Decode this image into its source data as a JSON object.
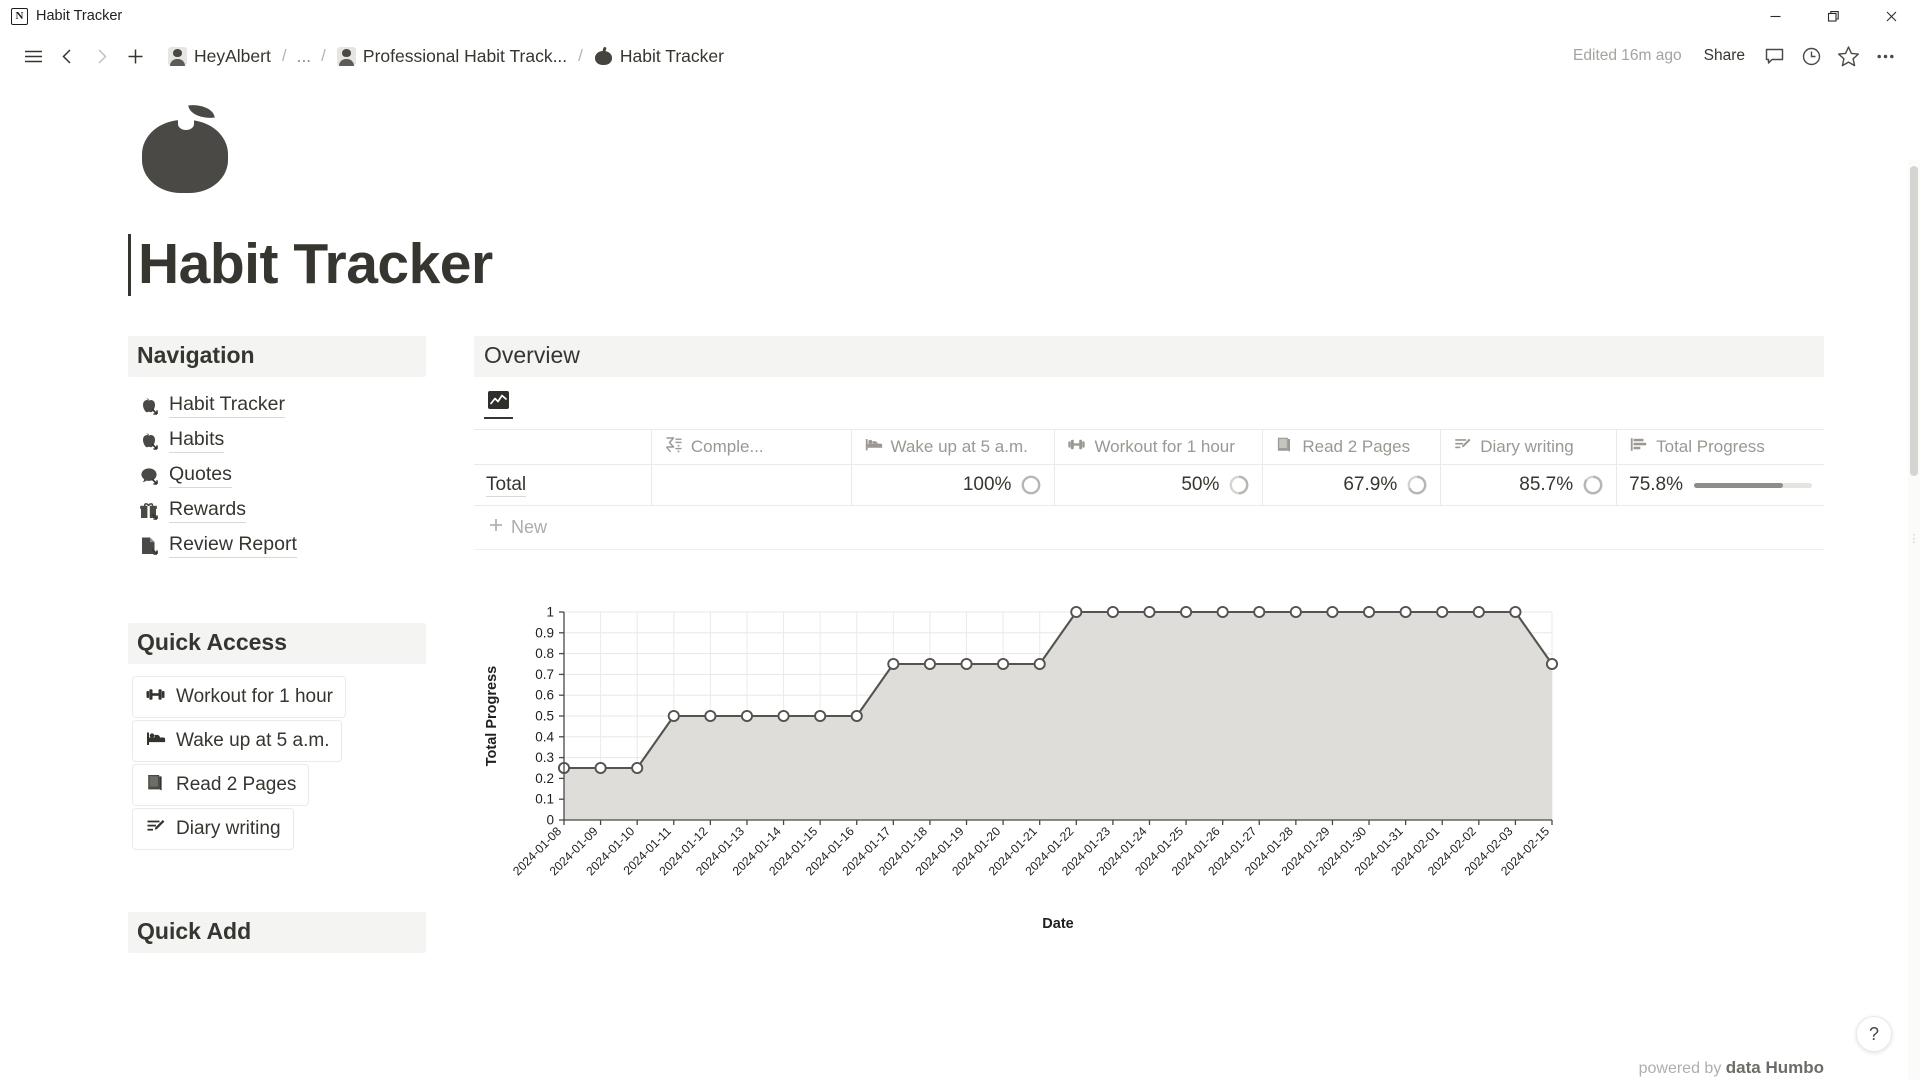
{
  "window": {
    "app_icon": "notion-icon",
    "title": "Habit Tracker",
    "minimize_label": "Minimize",
    "restore_label": "Restore",
    "close_label": "Close"
  },
  "appbar": {
    "menu_label": "Menu",
    "back_label": "Back",
    "forward_label": "Forward",
    "new_label": "New",
    "breadcrumbs": [
      {
        "icon": "avatar-icon",
        "label": "HeyAlbert"
      },
      {
        "icon": "none",
        "label": "..."
      },
      {
        "icon": "avatar-icon",
        "label": "Professional Habit Track..."
      },
      {
        "icon": "apple-icon",
        "label": "Habit Tracker"
      }
    ],
    "separator": "/",
    "edited": "Edited 16m ago",
    "share_label": "Share",
    "comment_label": "Comments",
    "history_label": "Updates",
    "favorite_label": "Favorite",
    "more_label": "More"
  },
  "page": {
    "emoji": "apple-icon",
    "title": "Habit Tracker"
  },
  "navigation": {
    "heading": "Navigation",
    "items": [
      {
        "icon": "apple-icon",
        "label": "Habit Tracker"
      },
      {
        "icon": "apple-icon",
        "label": "Habits"
      },
      {
        "icon": "speech-bubble-icon",
        "label": "Quotes"
      },
      {
        "icon": "gift-icon",
        "label": "Rewards"
      },
      {
        "icon": "document-icon",
        "label": "Review Report"
      }
    ]
  },
  "quick_access": {
    "heading": "Quick Access",
    "items": [
      {
        "icon": "dumbbell-icon",
        "label": "Workout for 1 hour"
      },
      {
        "icon": "bed-icon",
        "label": "Wake up at 5 a.m."
      },
      {
        "icon": "book-icon",
        "label": "Read 2 Pages"
      },
      {
        "icon": "pencil-lines-icon",
        "label": "Diary writing"
      }
    ]
  },
  "quick_add": {
    "heading": "Quick Add"
  },
  "overview": {
    "heading": "Overview",
    "tab_icon": "line-chart-icon",
    "columns": [
      {
        "icon": "sigma-icon",
        "label": "Comple..."
      },
      {
        "icon": "bed-icon",
        "label": "Wake up at 5 a.m."
      },
      {
        "icon": "dumbbell-icon",
        "label": "Workout for 1 hour"
      },
      {
        "icon": "book-icon",
        "label": "Read 2 Pages"
      },
      {
        "icon": "pencil-lines-icon",
        "label": "Diary writing"
      },
      {
        "icon": "bar-chart-icon",
        "label": "Total Progress"
      }
    ],
    "rows": [
      {
        "name": "Total",
        "wake_up": "100%",
        "wake_up_pct": 100,
        "workout": "50%",
        "workout_pct": 50,
        "read": "67.9%",
        "read_pct": 67.9,
        "diary": "85.7%",
        "diary_pct": 85.7,
        "total_progress": "75.8%",
        "total_progress_pct": 75.8
      }
    ],
    "new_row_label": "New",
    "new_row_icon": "plus-icon"
  },
  "chart_data": {
    "type": "area",
    "title": "",
    "xlabel": "Date",
    "ylabel": "Total Progress",
    "ylim": [
      0,
      1
    ],
    "yticks": [
      0,
      0.1,
      0.2,
      0.3,
      0.4,
      0.5,
      0.6,
      0.7,
      0.8,
      0.9,
      1
    ],
    "ytick_labels": [
      "0",
      "0.1",
      "0.2",
      "0.3",
      "0.4",
      "0.5",
      "0.6",
      "0.7",
      "0.8",
      "0.9",
      "1"
    ],
    "grid": true,
    "legend": "none",
    "line_color": "#555350",
    "fill_color": "#dddbd8",
    "marker": "circle-open",
    "categories": [
      "2024-01-08",
      "2024-01-09",
      "2024-01-10",
      "2024-01-11",
      "2024-01-12",
      "2024-01-13",
      "2024-01-14",
      "2024-01-15",
      "2024-01-16",
      "2024-01-17",
      "2024-01-18",
      "2024-01-19",
      "2024-01-20",
      "2024-01-21",
      "2024-01-22",
      "2024-01-23",
      "2024-01-24",
      "2024-01-25",
      "2024-01-26",
      "2024-01-27",
      "2024-01-28",
      "2024-01-29",
      "2024-01-30",
      "2024-01-31",
      "2024-02-01",
      "2024-02-02",
      "2024-02-03",
      "2024-02-15"
    ],
    "values": [
      0.25,
      0.25,
      0.25,
      0.5,
      0.5,
      0.5,
      0.5,
      0.5,
      0.5,
      0.75,
      0.75,
      0.75,
      0.75,
      0.75,
      1,
      1,
      1,
      1,
      1,
      1,
      1,
      1,
      1,
      1,
      1,
      1,
      1,
      0.75
    ]
  },
  "footer": {
    "powered_prefix": "powered by",
    "powered_brand": "data Humbo"
  },
  "help": {
    "label": "?"
  }
}
